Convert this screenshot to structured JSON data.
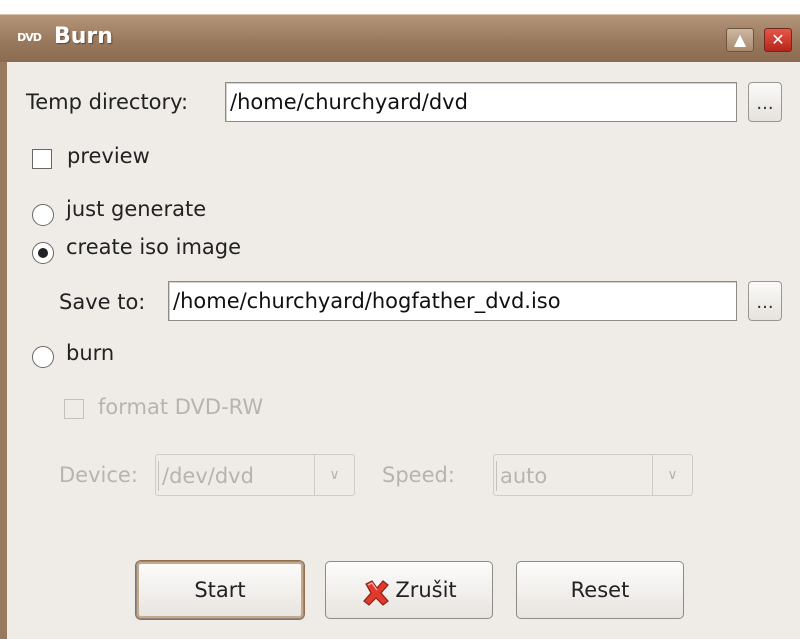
{
  "window": {
    "title": "Burn",
    "icon_text": "DVD",
    "maximize_glyph": "▲",
    "close_glyph": "✕"
  },
  "temp": {
    "label": "Temp directory:",
    "value": "/home/churchyard/dvd",
    "browse_label": "..."
  },
  "preview": {
    "label": "preview",
    "checked": false
  },
  "options": {
    "just_generate": {
      "label": "just generate",
      "selected": false
    },
    "create_iso": {
      "label": "create iso image",
      "selected": true
    },
    "burn": {
      "label": "burn",
      "selected": false
    }
  },
  "save": {
    "label": "Save to:",
    "value": "/home/churchyard/hogfather_dvd.iso",
    "browse_label": "..."
  },
  "format": {
    "label": "format DVD-RW",
    "checked": false,
    "enabled": false
  },
  "device": {
    "label": "Device:",
    "value": "/dev/dvd",
    "enabled": false
  },
  "speed": {
    "label": "Speed:",
    "value": "auto",
    "enabled": false
  },
  "buttons": {
    "start": "Start",
    "cancel": "Zrušit",
    "reset": "Reset"
  },
  "colors": {
    "titlebar": "#9a7a5e",
    "dialog_bg": "#efebe7",
    "disabled_text": "#b8b3ad"
  }
}
